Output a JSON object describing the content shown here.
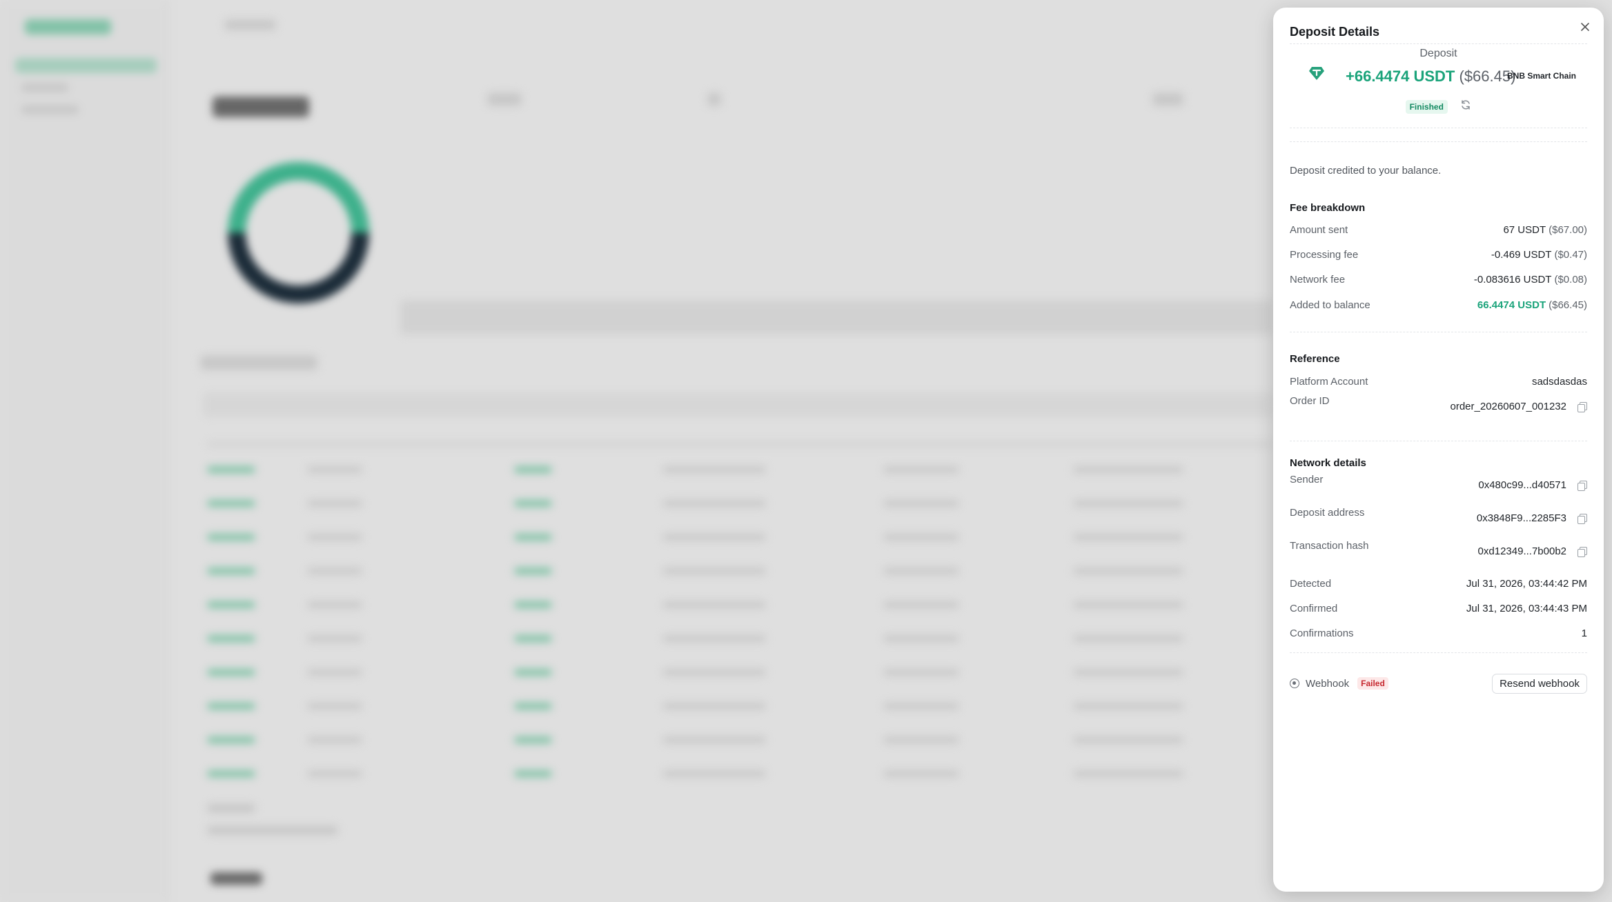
{
  "panel": {
    "title": "Deposit Details",
    "kind": "Deposit",
    "amount": "+66.4474 USDT",
    "amount_fiat": "($66.45)",
    "chain": "BNB Smart Chain",
    "status": "Finished",
    "note": "Deposit credited to your balance."
  },
  "fee_breakdown": {
    "title": "Fee breakdown",
    "rows": [
      {
        "label": "Amount sent",
        "value": "67 USDT",
        "fiat": "($67.00)"
      },
      {
        "label": "Processing fee",
        "value": "-0.469 USDT",
        "fiat": "($0.47)"
      },
      {
        "label": "Network fee",
        "value": "-0.083616 USDT",
        "fiat": "($0.08)"
      },
      {
        "label": "Added to balance",
        "value": "66.4474 USDT",
        "fiat": "($66.45)"
      }
    ]
  },
  "reference": {
    "title": "Reference",
    "platform_account_label": "Platform Account",
    "platform_account": "sadsdasdas",
    "order_id_label": "Order ID",
    "order_id": "order_20260607_001232"
  },
  "network": {
    "title": "Network details",
    "sender_label": "Sender",
    "sender": "0x480c99...d40571",
    "deposit_address_label": "Deposit address",
    "deposit_address": "0x3848F9...2285F3",
    "tx_hash_label": "Transaction hash",
    "tx_hash": "0xd12349...7b00b2",
    "detected_label": "Detected",
    "detected": "Jul 31, 2026, 03:44:42 PM",
    "confirmed_label": "Confirmed",
    "confirmed": "Jul 31, 2026, 03:44:43 PM",
    "confirmations_label": "Confirmations",
    "confirmations": "1"
  },
  "webhook": {
    "label": "Webhook",
    "status": "Failed",
    "resend_label": "Resend webhook"
  },
  "colors": {
    "accent": "#1aa37a",
    "failed": "#c6282f"
  }
}
